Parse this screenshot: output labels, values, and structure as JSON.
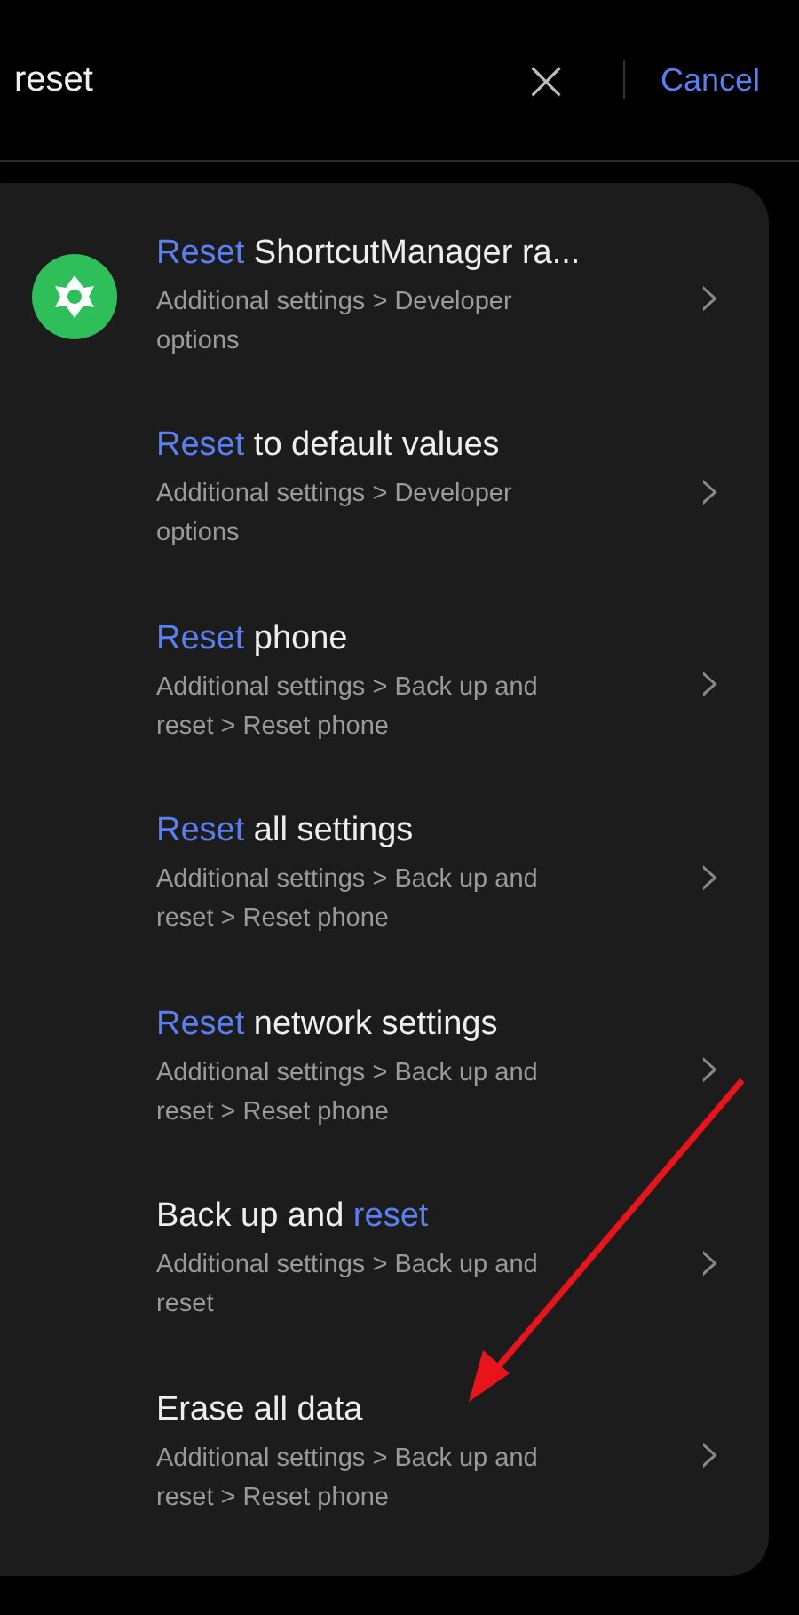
{
  "search": {
    "value": "reset",
    "clear": "×",
    "cancel": "Cancel"
  },
  "results": [
    {
      "title": [
        {
          "text": "Reset",
          "highlight": true
        },
        {
          "text": " ShortcutManager ra...",
          "highlight": false
        }
      ],
      "path": "Additional settings > Developer options",
      "chevron": "›"
    },
    {
      "title": [
        {
          "text": "Reset",
          "highlight": true
        },
        {
          "text": " to default values",
          "highlight": false
        }
      ],
      "path": "Additional settings > Developer options",
      "chevron": "›"
    },
    {
      "title": [
        {
          "text": "Reset",
          "highlight": true
        },
        {
          "text": " phone",
          "highlight": false
        }
      ],
      "path": "Additional settings > Back up and reset > Reset phone",
      "chevron": "›"
    },
    {
      "title": [
        {
          "text": "Reset",
          "highlight": true
        },
        {
          "text": " all settings",
          "highlight": false
        }
      ],
      "path": "Additional settings > Back up and reset > Reset phone",
      "chevron": "›"
    },
    {
      "title": [
        {
          "text": "Reset",
          "highlight": true
        },
        {
          "text": " network settings",
          "highlight": false
        }
      ],
      "path": "Additional settings > Back up and reset > Reset phone",
      "chevron": "›"
    },
    {
      "title": [
        {
          "text": "Back up and ",
          "highlight": false
        },
        {
          "text": "reset",
          "highlight": true
        }
      ],
      "path": "Additional settings > Back up and reset",
      "chevron": "›"
    },
    {
      "title": [
        {
          "text": "Erase all data",
          "highlight": false
        }
      ],
      "path": "Additional settings > Back up and reset > Reset phone",
      "chevron": "›"
    }
  ],
  "annotation": {
    "kind": "arrow"
  }
}
